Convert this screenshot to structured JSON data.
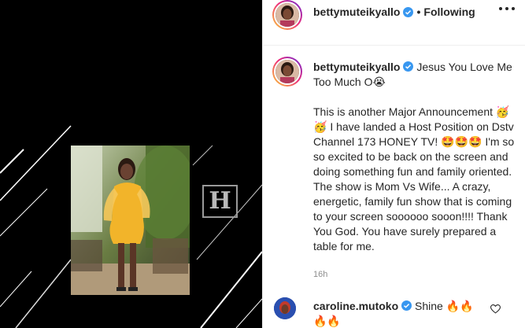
{
  "header": {
    "username": "bettymuteikyallo",
    "separator": "•",
    "follow_status": "Following",
    "avatar_icon": "profile-avatar",
    "verified_icon": "verified-badge-icon",
    "more_icon": "more-options-icon"
  },
  "caption": {
    "username": "bettymuteikyallo",
    "headline": " Jesus You Love Me Too Much O😭",
    "body": "This is another Major Announcement 🥳🥳 I have landed a Host Position on Dstv Channel 173 HONEY TV! 🤩🤩🤩 I'm so so excited to be back on the screen and doing something fun and family oriented. The show is Mom Vs Wife... A crazy, energetic, family fun show that is coming to your screen soooooo sooon!!!! Thank You God. You have surely prepared a table for me.",
    "timestamp": "16h"
  },
  "comment": {
    "username": "caroline.mutoko",
    "text": " Shine 🔥🔥🔥🔥"
  },
  "media": {
    "logo_text": "H"
  },
  "colors": {
    "verified": "#3897f0",
    "text": "#262626",
    "muted": "#8e8e8e",
    "dress": "#f2b42a"
  }
}
